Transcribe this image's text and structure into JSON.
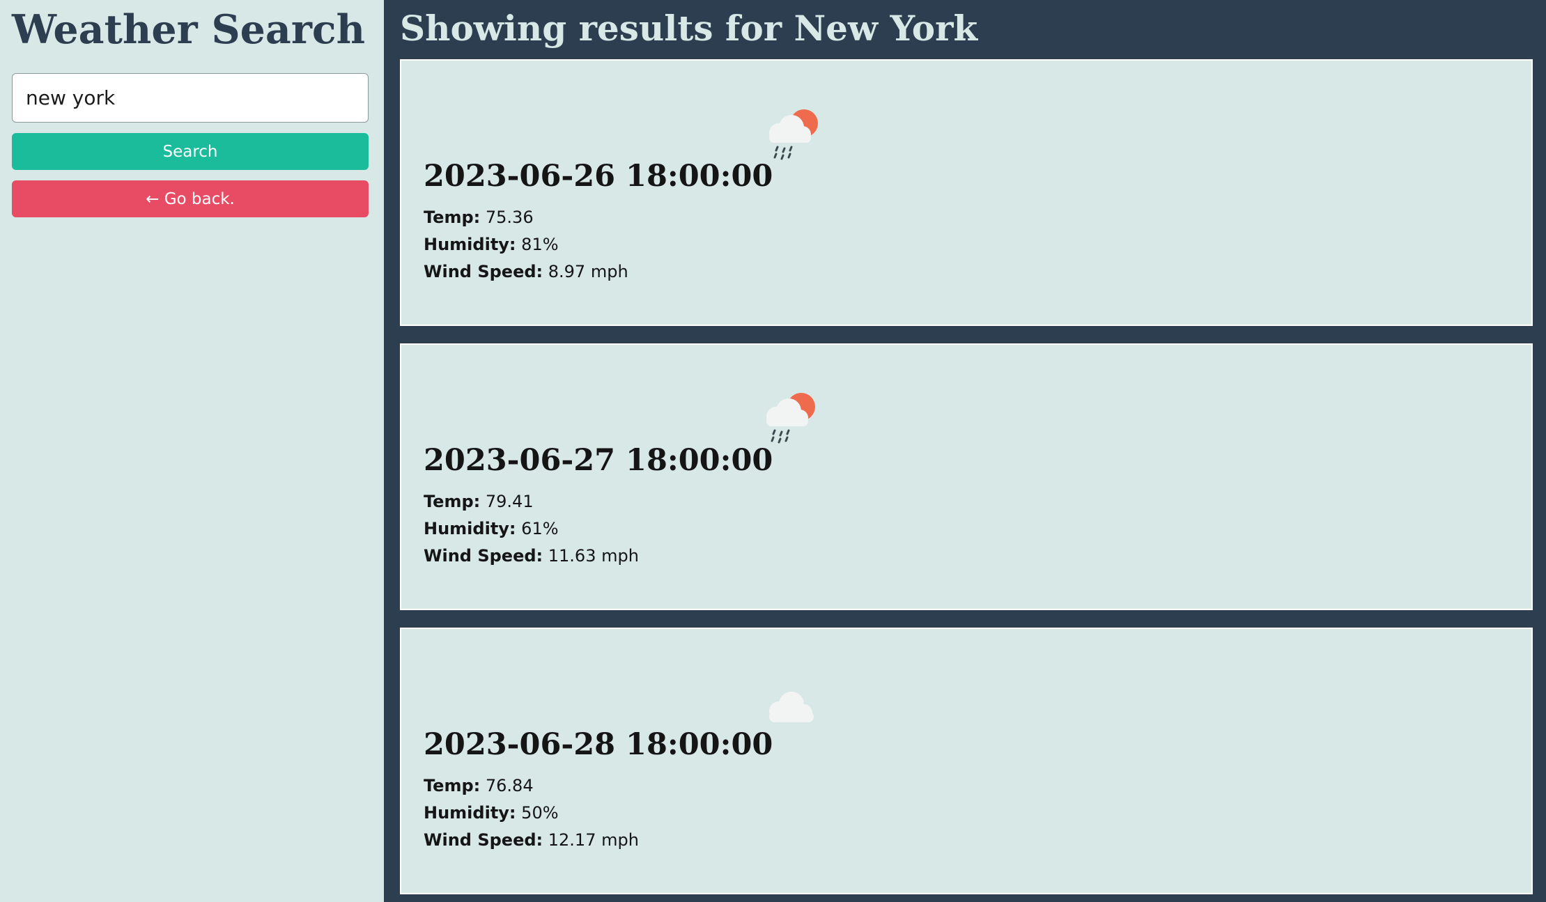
{
  "sidebar": {
    "title": "Weather Search",
    "search_input_value": "new york",
    "search_button_label": "Search",
    "back_button_label": "← Go back."
  },
  "main": {
    "results_title": "Showing results for New York",
    "labels": {
      "temp": "Temp:",
      "humidity": "Humidity:",
      "wind_speed": "Wind Speed:"
    },
    "forecasts": [
      {
        "datetime": "2023-06-26 18:00:00",
        "icon": "rain-sun-icon",
        "temp": "75.36",
        "humidity": "81%",
        "wind_speed": "8.97 mph"
      },
      {
        "datetime": "2023-06-27 18:00:00",
        "icon": "rain-sun-icon",
        "temp": "79.41",
        "humidity": "61%",
        "wind_speed": "11.63 mph"
      },
      {
        "datetime": "2023-06-28 18:00:00",
        "icon": "cloud-icon",
        "temp": "76.84",
        "humidity": "50%",
        "wind_speed": "12.17 mph"
      }
    ]
  },
  "colors": {
    "sidebar_bg": "#d8e8e7",
    "main_bg": "#2c3e50",
    "search_button": "#1abc9c",
    "back_button": "#e74c64",
    "sun": "#ee6b4d",
    "cloud": "#f2f4f4"
  }
}
